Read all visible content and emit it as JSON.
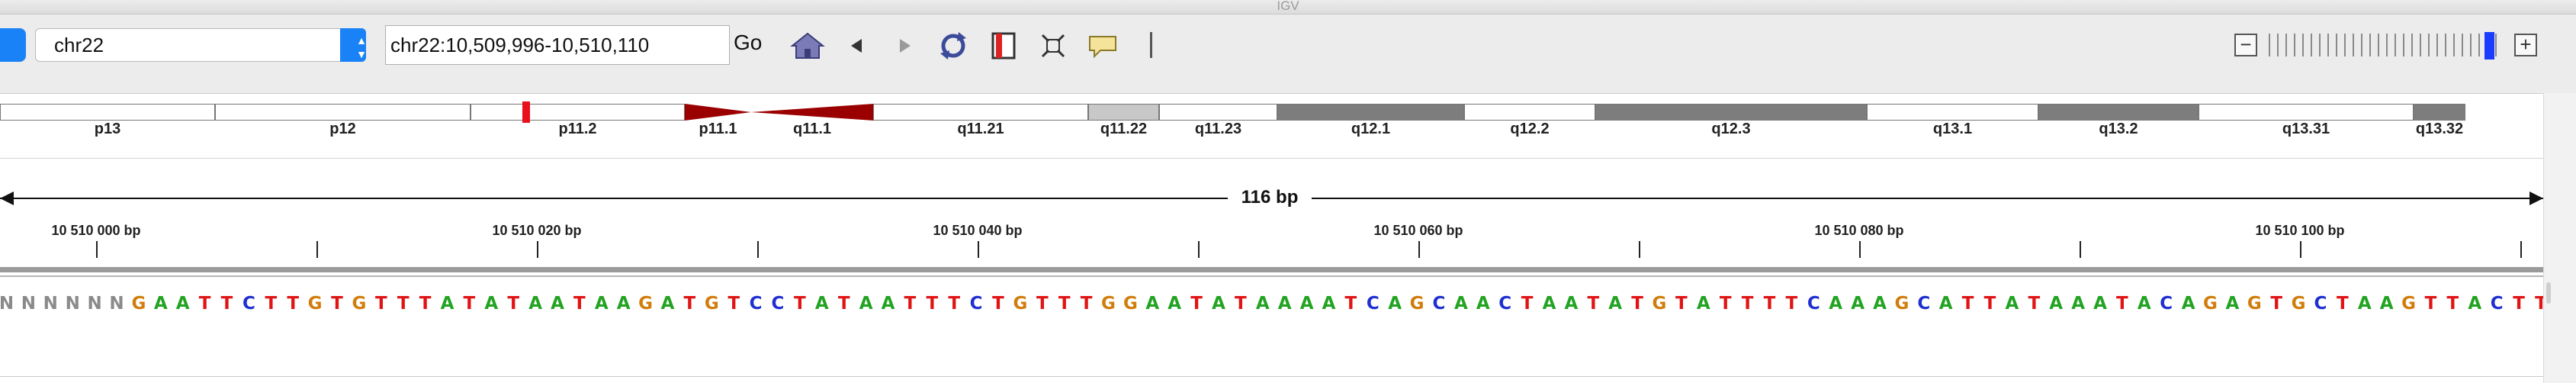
{
  "window": {
    "title": "IGV"
  },
  "toolbar": {
    "chromosome": "chr22",
    "chromosome_arrows": "▲▼",
    "locus": "chr22:10,509,996-10,510,110",
    "go_label": "Go",
    "zoom_minus": "−",
    "zoom_plus": "+",
    "zoom_level_fraction": 0.95,
    "icons": [
      "home-icon",
      "back-icon",
      "forward-icon",
      "refresh-icon",
      "region-of-interest-icon",
      "resize-to-window-icon",
      "popup-info-icon"
    ]
  },
  "ideogram": {
    "bands": [
      {
        "name": "p13",
        "color": "#ffffff"
      },
      {
        "name": "p12",
        "color": "#ffffff"
      },
      {
        "name": "p11.2",
        "color": "#ffffff"
      },
      {
        "name": "p11.1",
        "color": "#9b0000"
      },
      {
        "name": "q11.1",
        "color": "#9b0000"
      },
      {
        "name": "q11.21",
        "color": "#ffffff"
      },
      {
        "name": "q11.22",
        "color": "#c8c8c8"
      },
      {
        "name": "q11.23",
        "color": "#ffffff"
      },
      {
        "name": "q12.1",
        "color": "#7d7d7d"
      },
      {
        "name": "q12.2",
        "color": "#ffffff"
      },
      {
        "name": "q12.3",
        "color": "#7d7d7d"
      },
      {
        "name": "q13.1",
        "color": "#ffffff"
      },
      {
        "name": "q13.2",
        "color": "#7d7d7d"
      },
      {
        "name": "q13.31",
        "color": "#ffffff"
      },
      {
        "name": "q13.32",
        "color": "#7d7d7d"
      }
    ],
    "current_position_color": "#e8101a"
  },
  "ruler": {
    "span_label": "116 bp",
    "tick_labels": [
      "10 510 000 bp",
      "10 510 020 bp",
      "10 510 040 bp",
      "10 510 060 bp",
      "10 510 080 bp",
      "10 510 100 bp"
    ]
  },
  "sequence": {
    "bases": "NNNNNNGAATTCTTGTGTTTATATAATAAGATGTCCTATAATTTCTGTTTGGAATATAAAATCAGCAACTAATATGTATTTTCAAAGCATTATAAATACAGAGTGCTAAGTTACTTC",
    "colors": {
      "A": "#22a322",
      "C": "#1f2fd0",
      "G": "#d17d0b",
      "T": "#e01414",
      "N": "#8a8a8a"
    }
  }
}
